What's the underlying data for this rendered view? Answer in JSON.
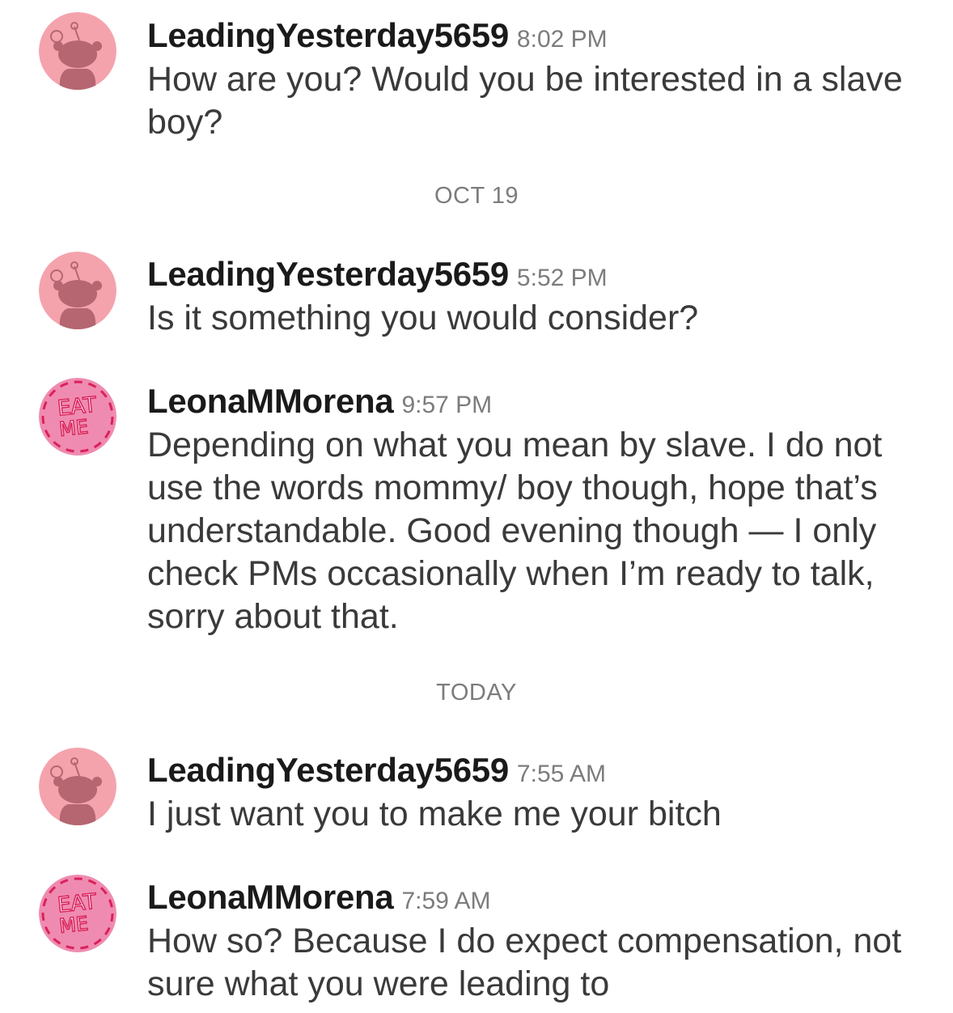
{
  "colors": {
    "snoo_avatar_bg": "#f4a3ad",
    "snoo_body": "#b56671",
    "eat_me_avatar_bg": "#ef8bb0",
    "eat_me_text": "#d9215b",
    "username": "#1a1a1b",
    "meta": "#7c7c7c",
    "body_text": "#3a3a3a"
  },
  "thread": {
    "messages": [
      {
        "user": "LeadingYesterday5659",
        "time": "8:02 PM",
        "avatar": "snoo-avatar-icon",
        "text": "How are you? Would you be interested in a slave boy?"
      },
      {
        "user": "LeadingYesterday5659",
        "time": "5:52 PM",
        "avatar": "snoo-avatar-icon",
        "text": "Is it something you would consider?"
      },
      {
        "user": "LeonaMMorena",
        "time": "9:57 PM",
        "avatar": "eat-me-avatar-icon",
        "avatar_lettering": "EAT ME",
        "text": "Depending on what you mean by slave. I do not use the words mommy/ boy though, hope that’s understandable. Good evening though — I only check PMs occasionally when I’m ready to talk, sorry about that."
      },
      {
        "user": "LeadingYesterday5659",
        "time": "7:55 AM",
        "avatar": "snoo-avatar-icon",
        "text": "I just want you to make me your bitch"
      },
      {
        "user": "LeonaMMorena",
        "time": "7:59 AM",
        "avatar": "eat-me-avatar-icon",
        "avatar_lettering": "EAT ME",
        "text": "How so? Because I do expect compensation, not sure what you were leading to"
      }
    ],
    "dividers": [
      "OCT 19",
      "TODAY"
    ]
  }
}
